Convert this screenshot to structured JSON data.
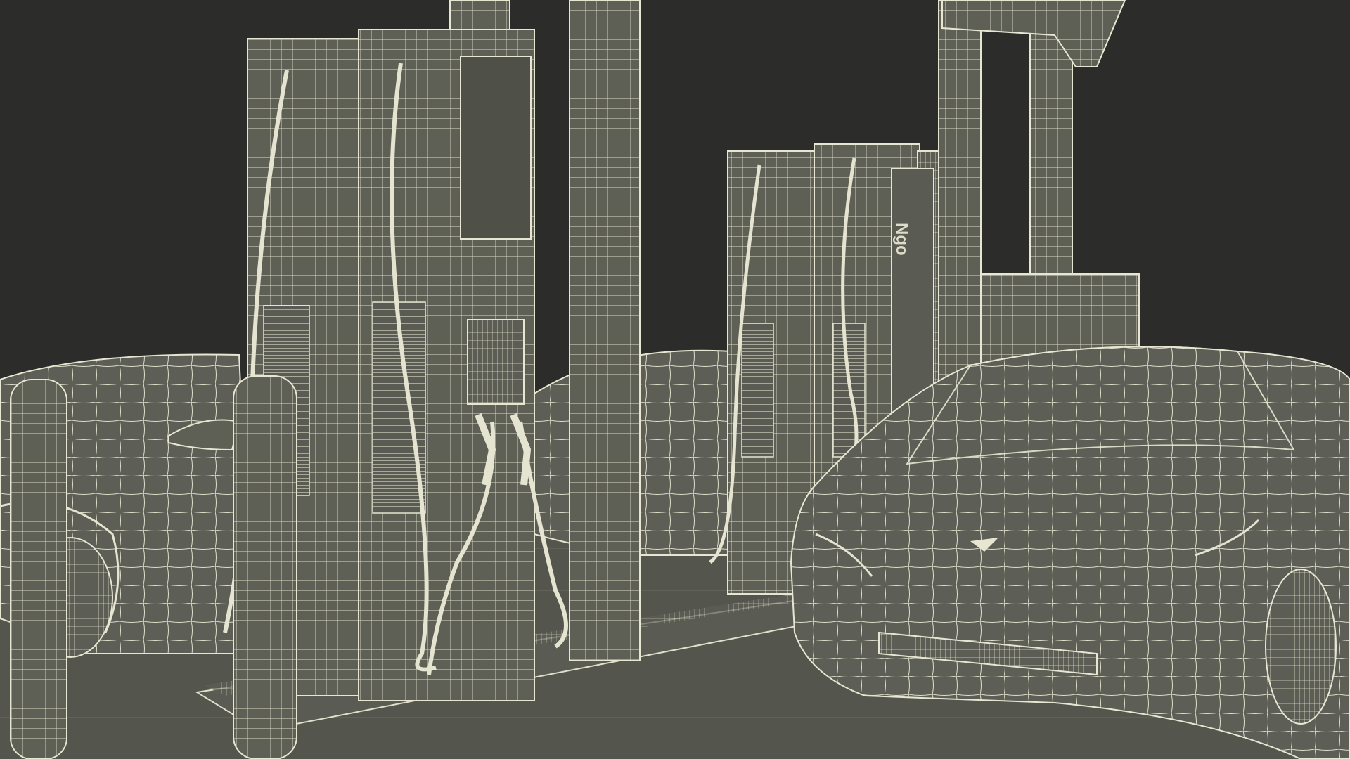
{
  "scene": {
    "sign_text": "Ngo",
    "colors": {
      "background": "#2c2c2a",
      "model_fill": "#5e5f55",
      "wireframe": "#e4e4d0",
      "floor": "#54554d"
    },
    "objects": [
      "ev-charger-pair-left",
      "ev-charger-pair-right",
      "canopy-columns",
      "bollards",
      "car-left",
      "car-center",
      "car-right",
      "pavement-island"
    ]
  }
}
